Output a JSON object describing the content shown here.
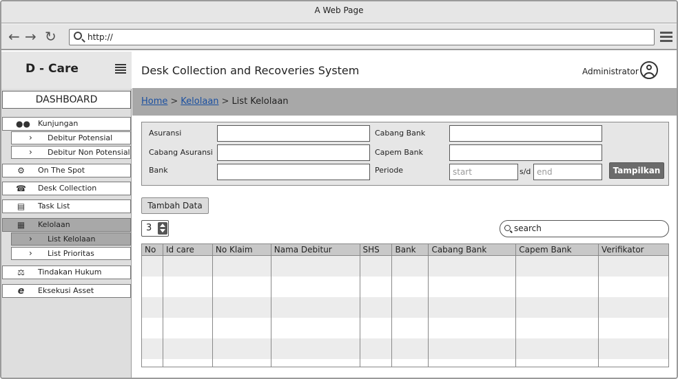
{
  "window": {
    "title": "A Web Page"
  },
  "browser": {
    "url": "http://"
  },
  "sidebar": {
    "brand": "D - Care",
    "dashboard": "DASHBOARD",
    "items": [
      {
        "label": "Kunjungan",
        "icon": "users-icon"
      },
      {
        "label": "Debitur Potensial",
        "sub": true
      },
      {
        "label": "Debitur Non Potensial",
        "sub": true
      },
      {
        "label": "On The Spot",
        "icon": "gear-icon"
      },
      {
        "label": "Desk Collection",
        "icon": "phone-icon"
      },
      {
        "label": "Task List",
        "icon": "document-icon"
      },
      {
        "label": "Kelolaan",
        "icon": "building-icon",
        "active": true
      },
      {
        "label": "List Kelolaan",
        "sub": true,
        "active": true
      },
      {
        "label": "List Prioritas",
        "sub": true
      },
      {
        "label": "Tindakan Hukum",
        "icon": "scale-icon"
      },
      {
        "label": "Eksekusi Asset",
        "icon": "ie-icon"
      }
    ]
  },
  "header": {
    "title": "Desk Collection and Recoveries System",
    "user": "Administrator"
  },
  "breadcrumb": {
    "home": "Home",
    "kelolaan": "Kelolaan",
    "current": "List Kelolaan",
    "separator": ">"
  },
  "filter": {
    "asuransi": "Asuransi",
    "cabang_asuransi": "Cabang Asuransi",
    "bank": "Bank",
    "cabang_bank": "Cabang Bank",
    "capem_bank": "Capem Bank",
    "periode": "Periode",
    "start_placeholder": "start",
    "sd": "s/d",
    "end_placeholder": "end",
    "submit": "Tampilkan"
  },
  "actions": {
    "add": "Tambah Data"
  },
  "pager": {
    "page_size": "3"
  },
  "search": {
    "placeholder": "search"
  },
  "table": {
    "headers": [
      "No",
      "Id care",
      "No Klaim",
      "Nama Debitur",
      "SHS",
      "Bank",
      "Cabang Bank",
      "Capem Bank",
      "Verifikator"
    ]
  },
  "colors": {
    "accent_link": "#1a4fa0",
    "button_dark": "#6b6b6b",
    "active_bg": "#a8a8a8"
  }
}
